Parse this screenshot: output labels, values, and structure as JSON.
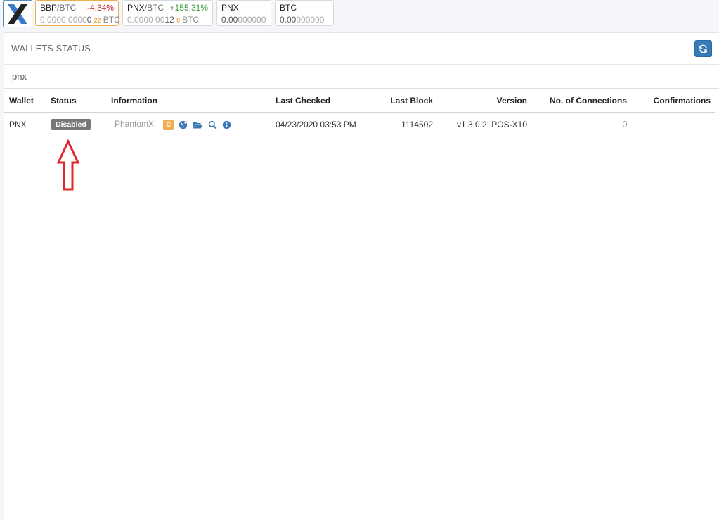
{
  "tickers": [
    {
      "symbol": "BBP",
      "quote": "/BTC",
      "change": "-4.34%",
      "price_main": "0.0000 0000",
      "price_dark": "0",
      "price_sub": "22",
      "unit": "BTC"
    },
    {
      "symbol": "PNX",
      "quote": "/BTC",
      "change": "+155.31%",
      "price_main": "0.0000 00",
      "price_dark": "12",
      "price_sub": "0",
      "unit": "BTC"
    },
    {
      "symbol": "PNX",
      "balance_dark": "0.00",
      "balance_light": "000000"
    },
    {
      "symbol": "BTC",
      "balance_dark": "0.00",
      "balance_light": "000000"
    }
  ],
  "panel": {
    "title": "WALLETS STATUS",
    "filter_value": "pnx"
  },
  "table": {
    "headers": [
      "Wallet",
      "Status",
      "Information",
      "Last Checked",
      "Last Block",
      "Version",
      "No. of Connections",
      "Confirmations"
    ],
    "rows": [
      {
        "wallet": "PNX",
        "status": "Disabled",
        "name": "PhantomX",
        "c_badge": "C",
        "icons": [
          "globe-icon",
          "folder-open-icon",
          "search-icon",
          "info-icon"
        ],
        "last_checked": "04/23/2020 03:53 PM",
        "last_block": "1114502",
        "version": "v1.3.0.2: POS-X10",
        "connections": "0",
        "confirmations": ""
      }
    ]
  },
  "colors": {
    "accent": "#337ab7",
    "negative": "#c9302c",
    "positive": "#3c9a3c",
    "badge": "#777777",
    "warning": "#f0ad4e",
    "arrow": "#e3262b"
  }
}
